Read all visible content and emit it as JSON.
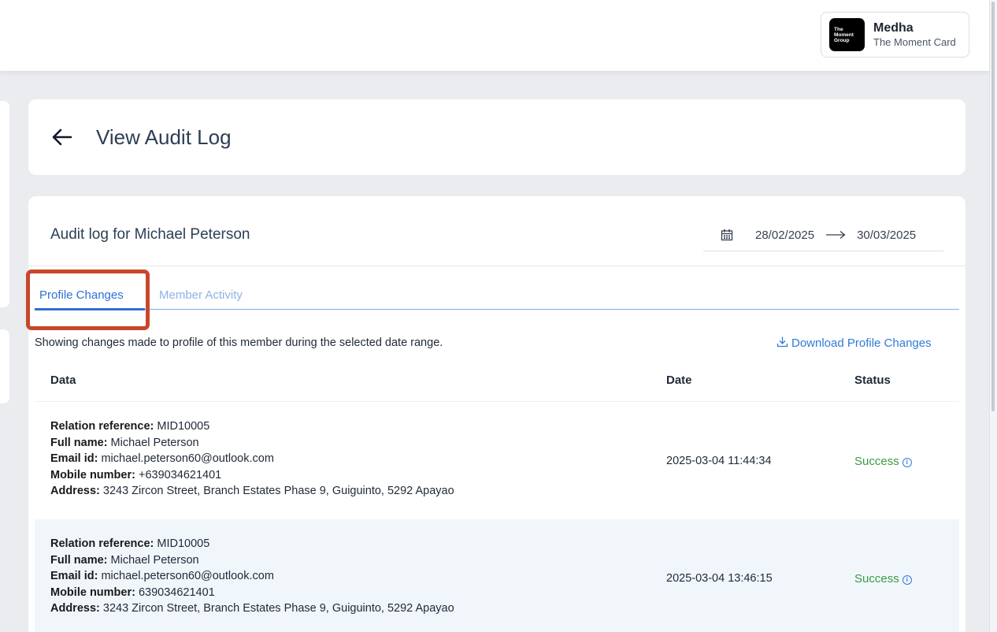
{
  "header": {
    "user_name": "Medha",
    "org_name": "The Moment Card",
    "logo_lines": [
      "The",
      "Moment",
      "Group"
    ]
  },
  "page": {
    "title": "View Audit Log",
    "back_icon": "arrow-left-icon"
  },
  "audit": {
    "title": "Audit log for Michael Peterson",
    "date_from": "28/02/2025",
    "date_to": "30/03/2025",
    "calendar_icon": "calendar-icon"
  },
  "tabs": [
    {
      "label": "Profile Changes",
      "active": true
    },
    {
      "label": "Member Activity",
      "active": false
    }
  ],
  "summary": "Showing changes made to profile of this member during the selected date range.",
  "download": {
    "label": "Download Profile Changes",
    "icon": "download-icon"
  },
  "table": {
    "headers": {
      "data": "Data",
      "date": "Date",
      "status": "Status"
    },
    "rows": [
      {
        "fields": [
          {
            "label": "Relation reference:",
            "value": "MID10005"
          },
          {
            "label": "Full name:",
            "value": "Michael Peterson"
          },
          {
            "label": "Email id:",
            "value": "michael.peterson60@outlook.com"
          },
          {
            "label": "Mobile number:",
            "value": "+639034621401"
          },
          {
            "label": "Address:",
            "value": "3243 Zircon Street, Branch Estates Phase 9, Guiguinto, 5292 Apayao"
          }
        ],
        "date": "2025-03-04 11:44:34",
        "status": "Success"
      },
      {
        "fields": [
          {
            "label": "Relation reference:",
            "value": "MID10005"
          },
          {
            "label": "Full name:",
            "value": "Michael Peterson"
          },
          {
            "label": "Email id:",
            "value": "michael.peterson60@outlook.com"
          },
          {
            "label": "Mobile number:",
            "value": "639034621401"
          },
          {
            "label": "Address:",
            "value": "3243 Zircon Street, Branch Estates Phase 9, Guiguinto, 5292 Apayao"
          }
        ],
        "date": "2025-03-04 13:46:15",
        "status": "Success"
      }
    ]
  },
  "colors": {
    "accent": "#2f6fd4",
    "success": "#3a9b46",
    "highlight": "#c8472b"
  }
}
